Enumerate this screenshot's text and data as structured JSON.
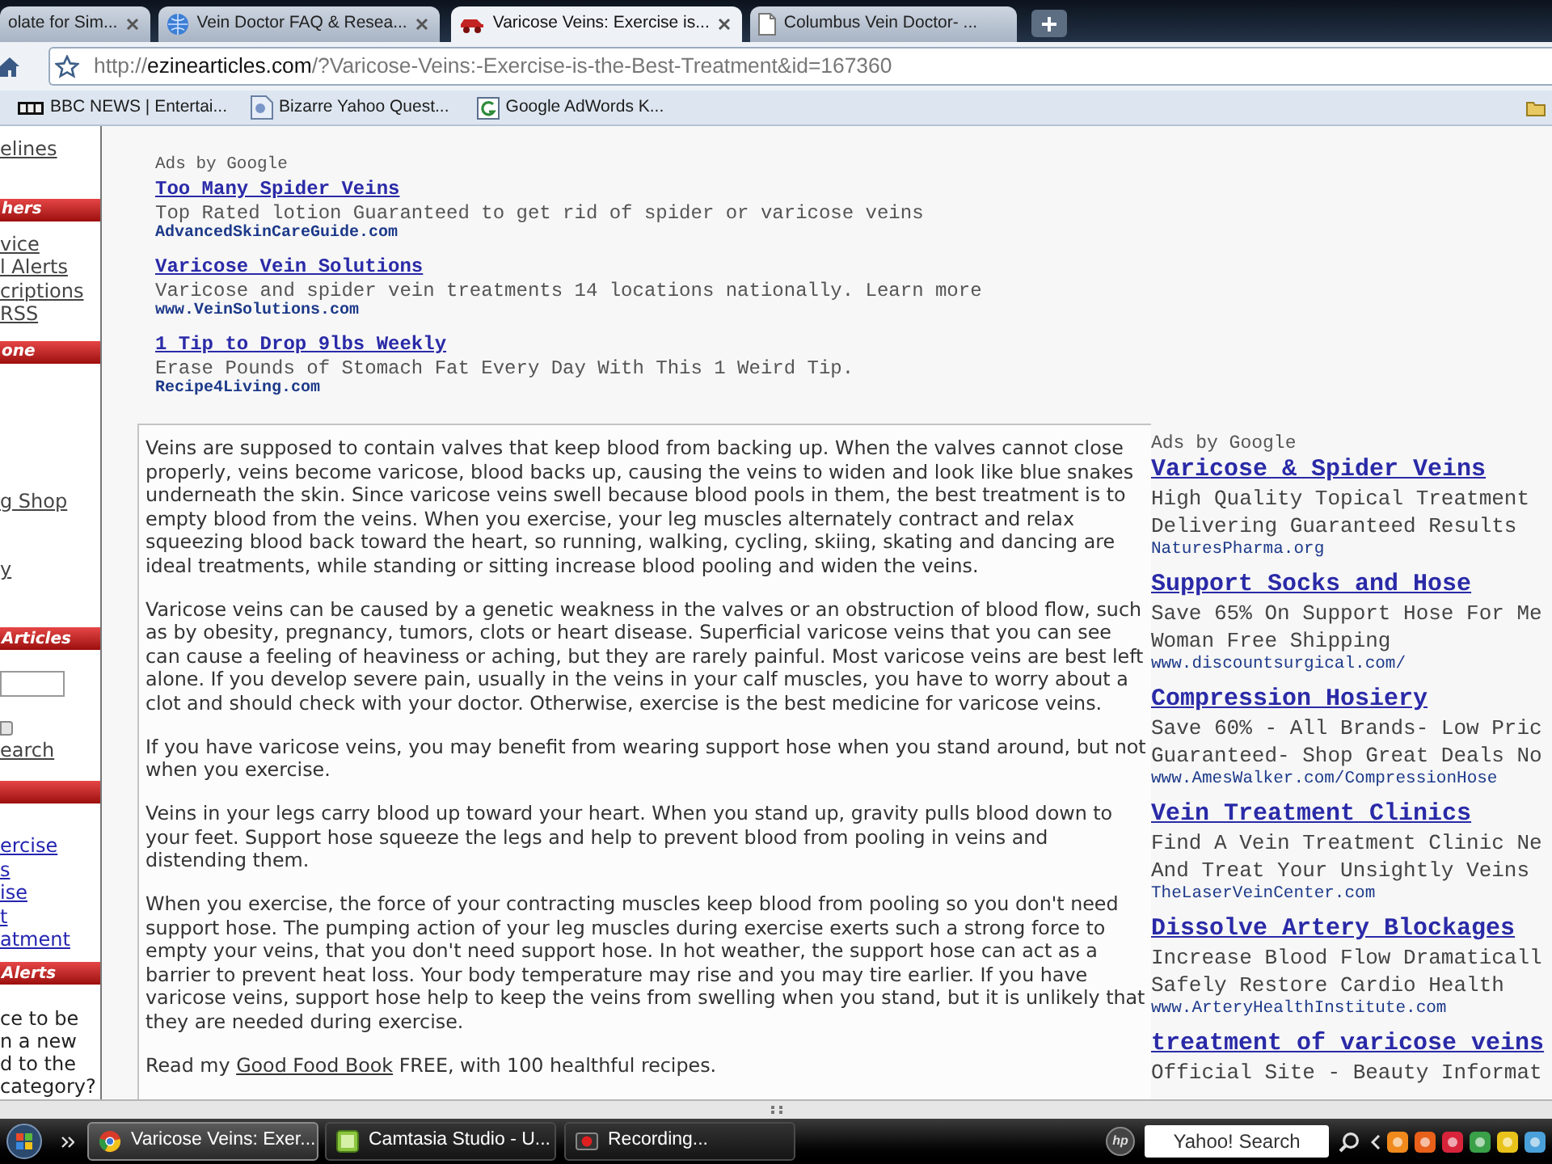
{
  "browser": {
    "tabs": [
      {
        "title": "olate for Sim...",
        "selected": false
      },
      {
        "title": "Vein Doctor FAQ & Resea...",
        "selected": false
      },
      {
        "title": "Varicose Veins: Exercise is...",
        "selected": true
      },
      {
        "title": "Columbus Vein Doctor- ...",
        "selected": false
      }
    ],
    "address_bar": {
      "url_parts": [
        {
          "text": "http://",
          "kind": "dim"
        },
        {
          "text": "ezinearticles.com",
          "kind": "host"
        },
        {
          "text": "/?Varicose-Veins:-Exercise-is-the-Best-Treatment&id=167360",
          "kind": "dim"
        }
      ]
    },
    "bookmarks": [
      {
        "label": "BBC NEWS | Entertai..."
      },
      {
        "label": "Bizarre Yahoo Quest..."
      },
      {
        "label": "Google AdWords K..."
      }
    ]
  },
  "sidebar": {
    "top_links": [
      {
        "text": "elines"
      }
    ],
    "sections": [
      {
        "title": "hers",
        "items": [
          {
            "kind": "link",
            "text": "vice"
          },
          {
            "kind": "link",
            "text": "l Alerts"
          },
          {
            "kind": "link",
            "text": "criptions"
          },
          {
            "kind": "link",
            "text": "RSS"
          }
        ]
      },
      {
        "title": "one",
        "items": [
          {
            "kind": "link",
            "text": "g Shop"
          },
          {
            "kind": "link",
            "text": "y"
          }
        ]
      },
      {
        "title": "Articles",
        "items": [
          {
            "kind": "input"
          },
          {
            "kind": "button"
          },
          {
            "kind": "link",
            "text": "earch"
          }
        ]
      },
      {
        "items": [
          {
            "kind": "article_link",
            "text": "ercise"
          },
          {
            "kind": "article_link",
            "text": "s"
          },
          {
            "kind": "article_link",
            "text": "ise"
          },
          {
            "kind": "article_link",
            "text": "t"
          },
          {
            "kind": "article_link",
            "text": "atment"
          }
        ]
      },
      {
        "title": "Alerts",
        "items": [
          {
            "kind": "text",
            "text": "ce to be"
          },
          {
            "kind": "text",
            "text": "n a new"
          },
          {
            "kind": "text",
            "text": "d to the"
          },
          {
            "kind": "text",
            "text": "category?"
          }
        ]
      }
    ]
  },
  "top_ads": {
    "label": "Ads by Google",
    "ads": [
      {
        "title": "Too Many Spider Veins",
        "lines": [
          "Top Rated lotion Guaranteed to get rid of spider or varicose veins"
        ],
        "url": "AdvancedSkinCareGuide.com"
      },
      {
        "title": "Varicose Vein Solutions",
        "lines": [
          "Varicose and spider vein treatments 14 locations nationally. Learn more"
        ],
        "url": "www.VeinSolutions.com"
      },
      {
        "title": "1 Tip to Drop 9lbs Weekly",
        "lines": [
          "Erase Pounds of Stomach Fat Every Day With This 1 Weird Tip."
        ],
        "url": "Recipe4Living.com"
      }
    ]
  },
  "article": {
    "paragraphs": [
      [
        {
          "text": "Veins are supposed to contain valves that keep blood from backing up. When the valves cannot close properly, veins become varicose, blood backs up, causing the veins to widen and look like blue snakes underneath the skin. Since varicose veins swell because blood pools in them, the best treatment is to empty blood from the veins. When you exercise, your leg muscles alternately contract and relax squeezing blood back toward the heart, so running, walking, cycling, skiing, skating and dancing are ideal treatments, while standing or sitting increase blood pooling and widen the veins."
        }
      ],
      [
        {
          "text": "Varicose veins can be caused by a genetic weakness in the valves or an obstruction of blood flow, such as by obesity, pregnancy, tumors, clots or heart disease. Superficial varicose veins that you can see can cause a feeling of heaviness or aching, but they are rarely painful. Most varicose veins are best left alone. If you develop severe pain, usually in the veins in your calf muscles, you have to worry about a clot and should check with your doctor. Otherwise, exercise is the best medicine for varicose veins."
        }
      ],
      [
        {
          "text": "If you have varicose veins, you may benefit from wearing support hose when you stand around, but not when you exercise."
        }
      ],
      [
        {
          "text": "Veins in your legs carry blood up toward your heart. When you stand up, gravity pulls blood down to your feet. Support hose squeeze the legs and help to prevent blood from pooling in veins and distending them."
        }
      ],
      [
        {
          "text": "When you exercise, the force of your contracting muscles keep blood from pooling so you don't need support hose. The pumping action of your leg muscles during exercise exerts such a strong force to empty your veins, that you don't need support hose. In hot weather, the support hose can act as a barrier to prevent heat loss. Your body temperature may rise and you may tire earlier. If you have varicose veins, support hose help to keep the veins from swelling when you stand, but it is unlikely that they are needed during exercise."
        }
      ],
      [
        {
          "text": "Read my "
        },
        {
          "text": "Good Food Book",
          "kind": "link"
        },
        {
          "text": " FREE, with 100 healthful recipes."
        }
      ]
    ]
  },
  "side_ads": {
    "label": "Ads by Google",
    "ads": [
      {
        "title": "Varicose & Spider Veins",
        "lines": [
          "High Quality Topical Treatment",
          "Delivering Guaranteed Results"
        ],
        "url": "NaturesPharma.org"
      },
      {
        "title": "Support Socks and Hose",
        "lines": [
          "Save 65% On Support Hose For Me",
          "Woman Free Shipping"
        ],
        "url": "www.discountsurgical.com/"
      },
      {
        "title": "Compression Hosiery",
        "lines": [
          "Save 60% - All Brands- Low Pric",
          "Guaranteed- Shop Great Deals No"
        ],
        "url": "www.AmesWalker.com/CompressionHose"
      },
      {
        "title": "Vein Treatment Clinics",
        "lines": [
          "Find A Vein Treatment Clinic Ne",
          "And Treat Your Unsightly Veins"
        ],
        "url": "TheLaserVeinCenter.com"
      },
      {
        "title": "Dissolve Artery Blockages",
        "lines": [
          "Increase Blood Flow Dramaticall",
          "Safely Restore Cardio Health"
        ],
        "url": "www.ArteryHealthInstitute.com"
      },
      {
        "title": "treatment of varicose veins",
        "lines": [
          "Official Site - Beauty Informat"
        ]
      }
    ]
  },
  "taskbar": {
    "buttons": [
      {
        "label": "Varicose Veins: Exer...",
        "selected": true
      },
      {
        "label": "Camtasia Studio - U...",
        "selected": false
      },
      {
        "label": "Recording...",
        "selected": false
      }
    ],
    "logo": "hp",
    "search": {
      "placeholder": "Yahoo! Search"
    }
  }
}
